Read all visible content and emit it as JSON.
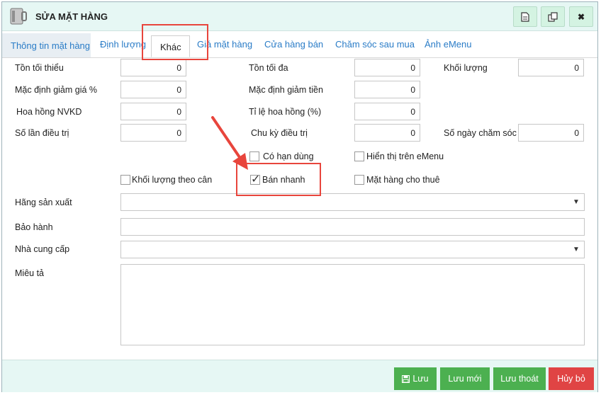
{
  "window": {
    "title": "SỬA MẶT HÀNG"
  },
  "title_buttons": {
    "close": "✖"
  },
  "tabs": [
    "Thông tin mặt hàng",
    "Định lượng",
    "Khác",
    "Giá mặt hàng",
    "Cửa hàng bán",
    "Chăm sóc sau mua",
    "Ảnh eMenu"
  ],
  "fields": {
    "ton_toi_thieu": {
      "label": "Tồn tối thiểu",
      "value": "0"
    },
    "ton_toi_da": {
      "label": "Tồn tối đa",
      "value": "0"
    },
    "khoi_luong": {
      "label": "Khối lượng",
      "value": "0"
    },
    "giam_gia_pct": {
      "label": "Mặc định giảm giá %",
      "value": "0"
    },
    "giam_tien": {
      "label": "Mặc định giảm tiền",
      "value": "0"
    },
    "hoa_hong_nvkd": {
      "label": "Hoa hồng NVKD",
      "value": "0"
    },
    "ti_le_hoa_hong": {
      "label": "Tỉ lệ hoa hồng (%)",
      "value": "0"
    },
    "so_lan_dieu_tri": {
      "label": "Số lần điều trị",
      "value": "0"
    },
    "chu_ky_dieu_tri": {
      "label": "Chu kỳ điều trị",
      "value": "0"
    },
    "so_ngay_cham_soc": {
      "label": "Số ngày chăm sóc",
      "value": "0"
    }
  },
  "checkboxes": {
    "co_han_dung": {
      "label": "Có hạn dùng",
      "checked": false
    },
    "hien_thi_emenu": {
      "label": "Hiển thị trên eMenu",
      "checked": false
    },
    "khoi_luong_theo_can": {
      "label": "Khối lượng theo cân",
      "checked": false
    },
    "ban_nhanh": {
      "label": "Bán nhanh",
      "checked": true,
      "mark": "✓"
    },
    "mat_hang_cho_thue": {
      "label": "Mặt hàng cho thuê",
      "checked": false
    }
  },
  "selects": {
    "hang_san_xuat": {
      "label": "Hãng sản xuất",
      "value": ""
    },
    "bao_hanh": {
      "label": "Bảo hành",
      "value": ""
    },
    "nha_cung_cap": {
      "label": "Nhà cung cấp",
      "value": ""
    },
    "mieu_ta": {
      "label": "Miêu tả",
      "value": ""
    }
  },
  "footer": {
    "save": "Lưu",
    "save_new": "Lưu mới",
    "save_exit": "Lưu thoát",
    "cancel": "Hủy bỏ"
  },
  "colors": {
    "accent_green": "#4cb050",
    "danger_red": "#e04444",
    "annotation_red": "#e8453c",
    "link_blue": "#2a7cc7"
  }
}
